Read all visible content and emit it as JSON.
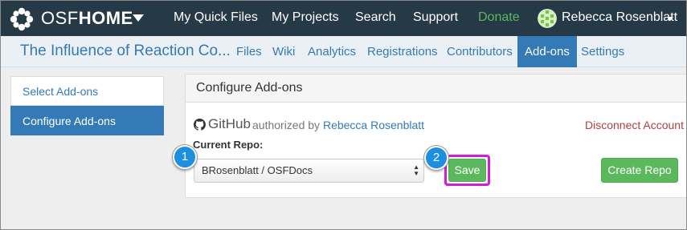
{
  "brand": {
    "prefix": "OSF",
    "bold": "HOME"
  },
  "topnav": {
    "items": [
      "My Quick Files",
      "My Projects",
      "Search",
      "Support",
      "Donate"
    ],
    "user": "Rebecca Rosenblatt"
  },
  "project": {
    "title": "The Influence of Reaction Co...",
    "tabs": [
      "Files",
      "Wiki",
      "Analytics",
      "Registrations",
      "Contributors",
      "Add-ons",
      "Settings"
    ],
    "active_tab": "Add-ons"
  },
  "sidebar": {
    "items": [
      {
        "label": "Select Add-ons",
        "active": false
      },
      {
        "label": "Configure Add-ons",
        "active": true
      }
    ]
  },
  "panel": {
    "heading": "Configure Add-ons",
    "addon": {
      "name": "GitHub",
      "authorized_prefix": "authorized by",
      "authorized_user": "Rebecca Rosenblatt",
      "disconnect_label": "Disconnect Account",
      "repo_label": "Current Repo:",
      "repo_value": "BRosenblatt / OSFDocs",
      "save_label": "Save",
      "create_label": "Create Repo"
    }
  },
  "callouts": [
    "1",
    "2"
  ],
  "colors": {
    "navbar": "#263947",
    "accent": "#337ab7",
    "success": "#5cb85c",
    "danger": "#a94442",
    "highlight": "#d61ad6",
    "callout": "#1d8fe0"
  }
}
